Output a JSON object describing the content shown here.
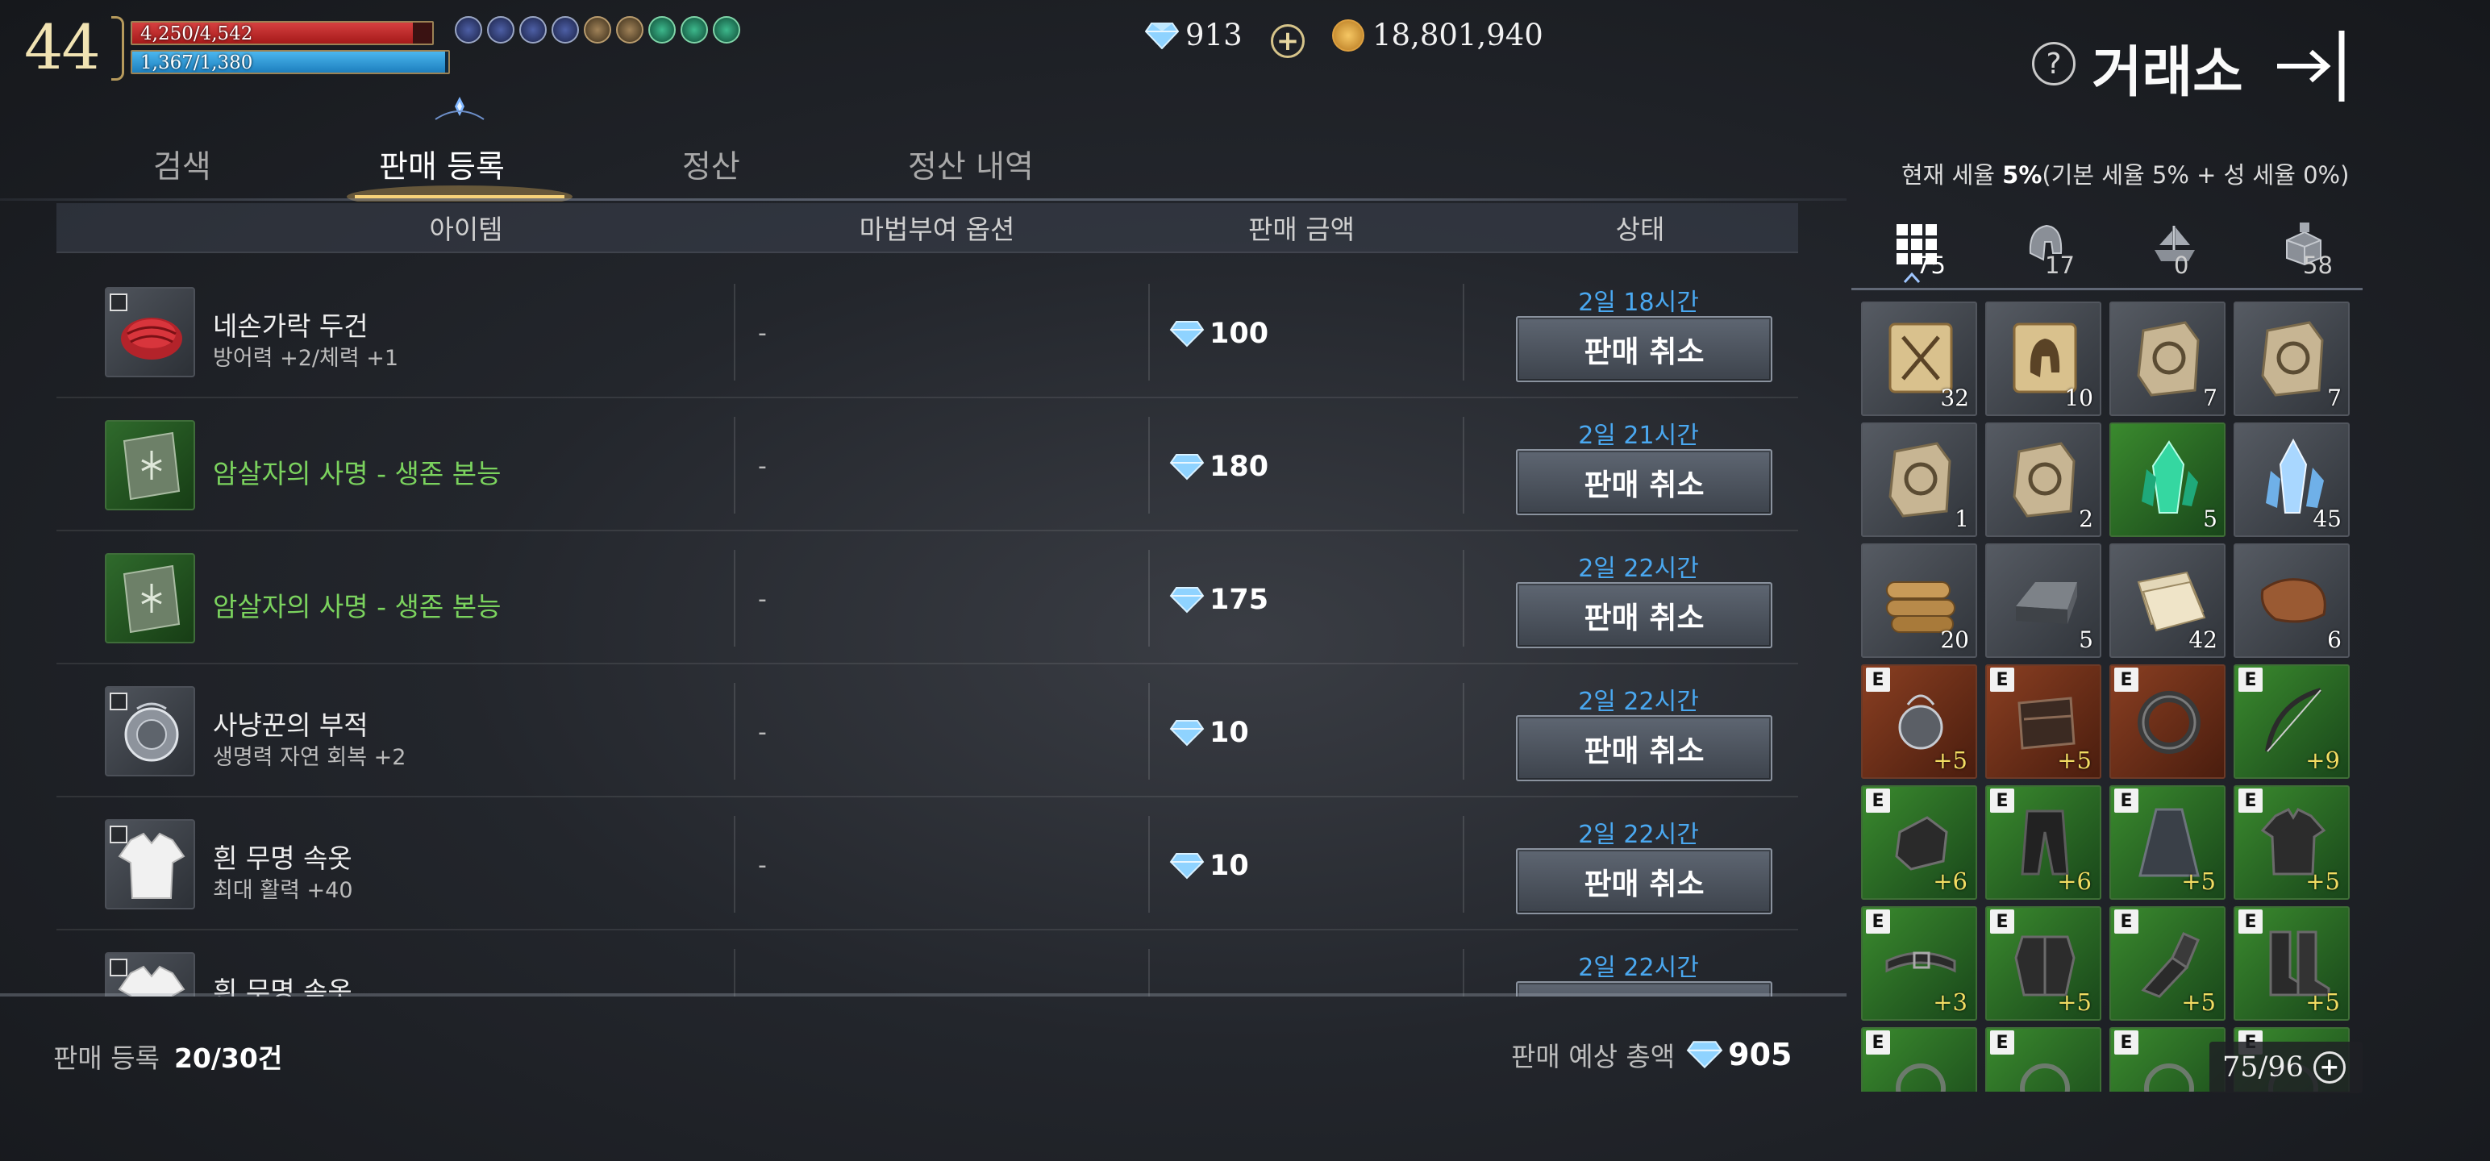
{
  "hud": {
    "level": "44",
    "hp": {
      "text": "4,250/4,542",
      "fraction": 0.936
    },
    "mp": {
      "text": "1,367/1,380",
      "fraction": 0.99
    },
    "buff_icons": [
      "buff-icon",
      "buff-icon",
      "buff-icon",
      "buff-icon",
      "buff-icon",
      "buff-icon",
      "buff-icon",
      "buff-icon",
      "buff-icon"
    ],
    "gems": "913",
    "gold": "18,801,940"
  },
  "header": {
    "title": "거래소"
  },
  "tabs": [
    {
      "label": "검색",
      "active": false
    },
    {
      "label": "판매 등록",
      "active": true
    },
    {
      "label": "정산",
      "active": false
    },
    {
      "label": "정산 내역",
      "active": false
    }
  ],
  "tax": {
    "label": "현재 세율",
    "value": "5%",
    "detail": "(기본 세율 5% + 성 세율 0%)"
  },
  "table": {
    "columns": [
      "아이템",
      "마법부여 옵션",
      "판매 금액",
      "상태"
    ],
    "cancel_label": "판매 취소",
    "rows": [
      {
        "name": "네손가락 두건",
        "option": "방어력 +2/체력 +1",
        "enchant": "-",
        "price": "100",
        "status": "2일 18시간",
        "rarity": "common",
        "icon": "red-hood-icon"
      },
      {
        "name": "암살자의 사명 - 생존 본능",
        "option": "",
        "enchant": "-",
        "price": "180",
        "status": "2일 21시간",
        "rarity": "uncommon",
        "icon": "skill-book-icon"
      },
      {
        "name": "암살자의 사명 - 생존 본능",
        "option": "",
        "enchant": "-",
        "price": "175",
        "status": "2일 22시간",
        "rarity": "uncommon",
        "icon": "skill-book-icon"
      },
      {
        "name": "사냥꾼의 부적",
        "option": "생명력 자연 회복 +2",
        "enchant": "-",
        "price": "10",
        "status": "2일 22시간",
        "rarity": "common",
        "icon": "amulet-icon"
      },
      {
        "name": "흰 무명 속옷",
        "option": "최대 활력 +40",
        "enchant": "-",
        "price": "10",
        "status": "2일 22시간",
        "rarity": "common",
        "icon": "white-shirt-icon"
      },
      {
        "name": "흰 무명 속옷",
        "option": "",
        "enchant": "",
        "price": "",
        "status": "2일 22시간",
        "rarity": "common",
        "icon": "white-shirt-icon"
      }
    ]
  },
  "footer": {
    "listing_label": "판매 등록",
    "listing_count": "20/30건",
    "total_label": "판매 예상 총액",
    "total_value": "905"
  },
  "inventory": {
    "tabs": [
      {
        "icon": "grid-icon",
        "count": "75",
        "active": true
      },
      {
        "icon": "helmet-icon",
        "count": "17",
        "active": false
      },
      {
        "icon": "ship-icon",
        "count": "0",
        "active": false
      },
      {
        "icon": "crate-icon",
        "count": "58",
        "active": false
      }
    ],
    "items": [
      {
        "icon": "scroll-sword-icon",
        "bg": "gray",
        "qty": "32",
        "enh": "",
        "equipped": false
      },
      {
        "icon": "scroll-helmet-icon",
        "bg": "gray",
        "qty": "10",
        "enh": "",
        "equipped": false
      },
      {
        "icon": "stone-tablet-icon",
        "bg": "gray",
        "qty": "7",
        "enh": "",
        "equipped": false
      },
      {
        "icon": "stone-tablet-icon",
        "bg": "gray",
        "qty": "7",
        "enh": "",
        "equipped": false
      },
      {
        "icon": "stone-tablet-icon",
        "bg": "gray",
        "qty": "1",
        "enh": "",
        "equipped": false
      },
      {
        "icon": "stone-tablet-icon",
        "bg": "gray",
        "qty": "2",
        "enh": "",
        "equipped": false
      },
      {
        "icon": "green-crystal-icon",
        "bg": "green",
        "qty": "5",
        "enh": "",
        "equipped": false
      },
      {
        "icon": "blue-crystal-icon",
        "bg": "gray",
        "qty": "45",
        "enh": "",
        "equipped": false
      },
      {
        "icon": "wood-logs-icon",
        "bg": "gray",
        "qty": "20",
        "enh": "",
        "equipped": false
      },
      {
        "icon": "iron-ingot-icon",
        "bg": "gray",
        "qty": "5",
        "enh": "",
        "equipped": false
      },
      {
        "icon": "paper-icon",
        "bg": "gray",
        "qty": "42",
        "enh": "",
        "equipped": false
      },
      {
        "icon": "leather-icon",
        "bg": "gray",
        "qty": "6",
        "enh": "",
        "equipped": false
      },
      {
        "icon": "amulet-icon",
        "bg": "brown",
        "qty": "",
        "enh": "+5",
        "equipped": true
      },
      {
        "icon": "bracer-icon",
        "bg": "brown",
        "qty": "",
        "enh": "+5",
        "equipped": true
      },
      {
        "icon": "ring-icon",
        "bg": "brown",
        "qty": "",
        "enh": "",
        "equipped": true
      },
      {
        "icon": "bow-icon",
        "bg": "green",
        "qty": "",
        "enh": "+9",
        "equipped": true
      },
      {
        "icon": "glove-icon",
        "bg": "green",
        "qty": "",
        "enh": "+6",
        "equipped": true
      },
      {
        "icon": "pants-icon",
        "bg": "green",
        "qty": "",
        "enh": "+6",
        "equipped": true
      },
      {
        "icon": "cloak-icon",
        "bg": "green",
        "qty": "",
        "enh": "+5",
        "equipped": true
      },
      {
        "icon": "shirt-icon",
        "bg": "green",
        "qty": "",
        "enh": "+5",
        "equipped": true
      },
      {
        "icon": "belt-icon",
        "bg": "green",
        "qty": "",
        "enh": "+3",
        "equipped": true
      },
      {
        "icon": "armor-icon",
        "bg": "green",
        "qty": "",
        "enh": "+5",
        "equipped": true
      },
      {
        "icon": "gauntlet-icon",
        "bg": "green",
        "qty": "",
        "enh": "+5",
        "equipped": true
      },
      {
        "icon": "boots-icon",
        "bg": "green",
        "qty": "",
        "enh": "+5",
        "equipped": true
      },
      {
        "icon": "unknown-item-icon",
        "bg": "green",
        "qty": "",
        "enh": "",
        "equipped": true
      },
      {
        "icon": "unknown-item-icon",
        "bg": "green",
        "qty": "",
        "enh": "",
        "equipped": true
      },
      {
        "icon": "unknown-item-icon",
        "bg": "green",
        "qty": "",
        "enh": "",
        "equipped": true
      },
      {
        "icon": "unknown-item-icon",
        "bg": "green",
        "qty": "",
        "enh": "",
        "equipped": true
      }
    ],
    "count": "75/96"
  },
  "colors": {
    "status_blue": "#4aa8f0",
    "uncommon_green": "#7bd35e",
    "enhance_yellow": "#f2dc62"
  }
}
